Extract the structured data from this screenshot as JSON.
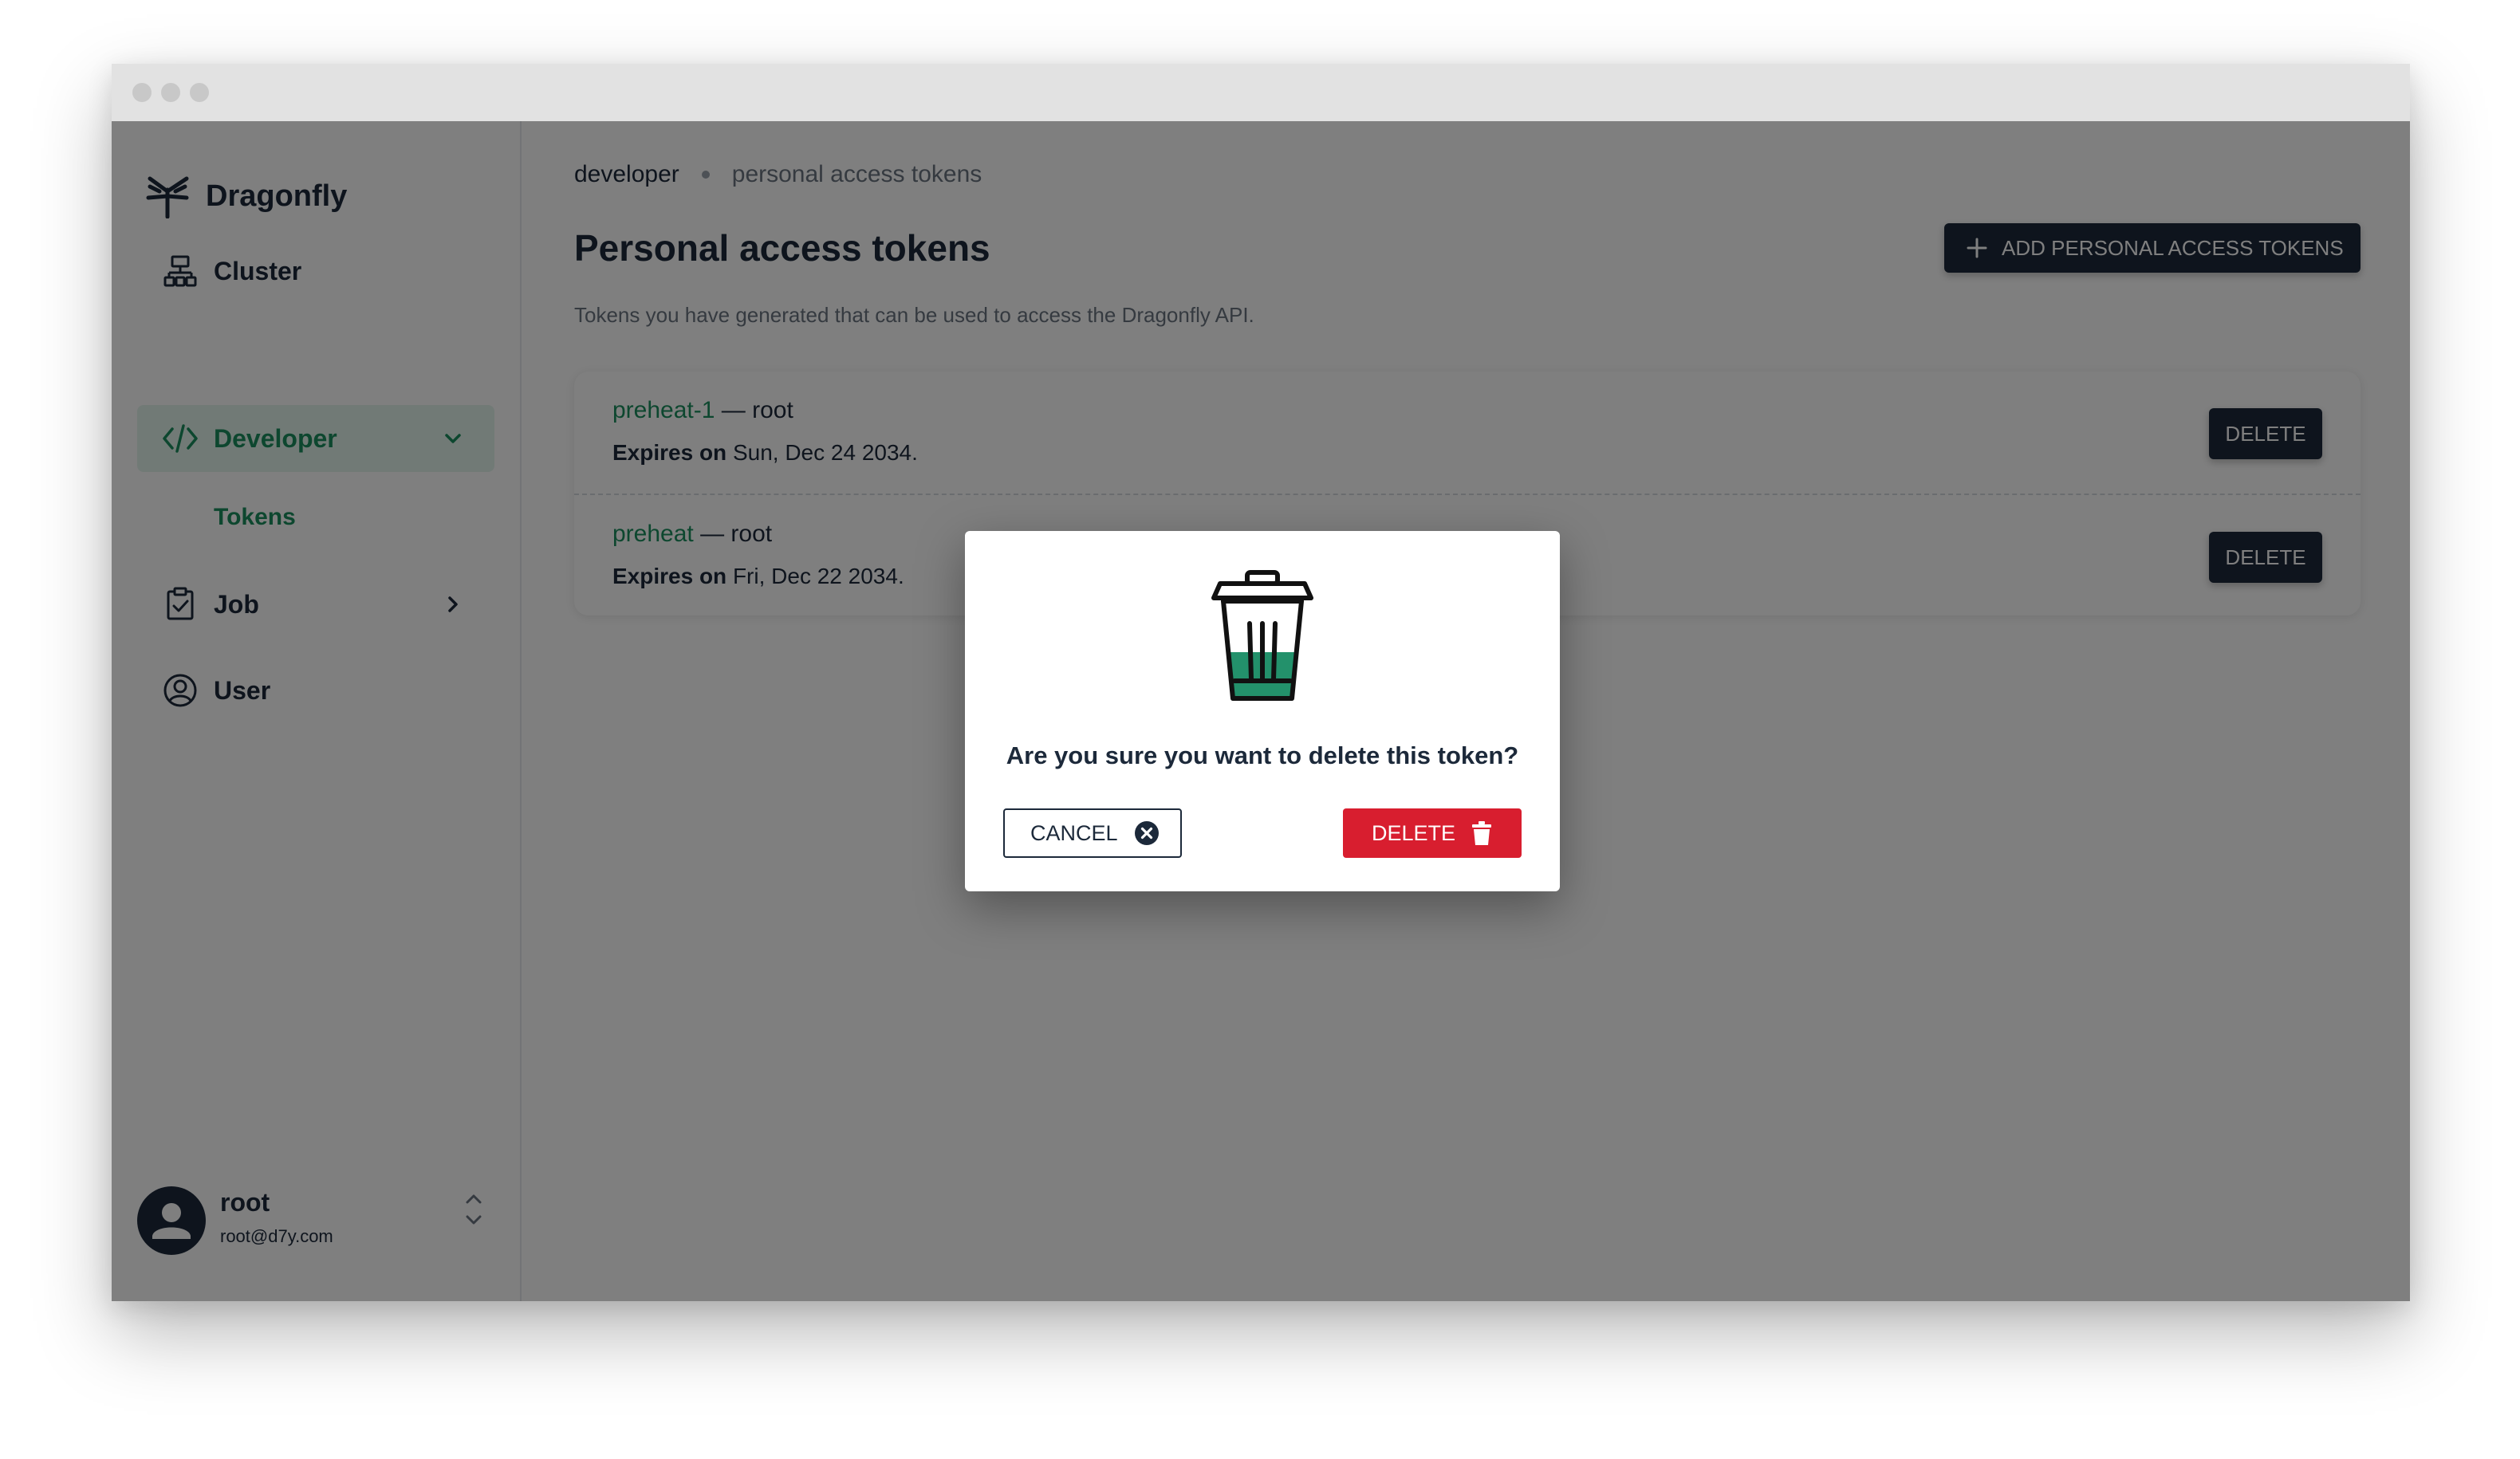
{
  "app": {
    "name": "Dragonfly"
  },
  "sidebar": {
    "items": [
      {
        "label": "Cluster",
        "icon": "cluster-icon"
      },
      {
        "label": "Developer",
        "icon": "code-icon",
        "active": true,
        "expanded": true
      },
      {
        "label": "Job",
        "icon": "clipboard-check-icon"
      },
      {
        "label": "User",
        "icon": "user-circle-icon"
      }
    ],
    "sub_items": [
      {
        "label": "Tokens"
      }
    ],
    "user": {
      "name": "root",
      "email": "root@d7y.com"
    }
  },
  "breadcrumb": {
    "items": [
      "developer",
      "personal access tokens"
    ]
  },
  "page": {
    "title": "Personal access tokens",
    "description": "Tokens you have generated that can be used to access the Dragonfly API.",
    "add_button": "ADD PERSONAL ACCESS TOKENS"
  },
  "tokens": [
    {
      "name": "preheat-1",
      "owner": "— root",
      "expires_label": "Expires on",
      "expires": "Sun, Dec 24 2034.",
      "delete_label": "DELETE"
    },
    {
      "name": "preheat",
      "owner": "— root",
      "expires_label": "Expires on",
      "expires": "Fri, Dec 22 2034.",
      "delete_label": "DELETE"
    }
  ],
  "modal": {
    "question": "Are you sure you want to delete this token?",
    "cancel_label": "CANCEL",
    "delete_label": "DELETE"
  },
  "colors": {
    "primary_dark": "#1c293a",
    "accent_green": "#1b8f5e",
    "danger": "#d81e2f",
    "active_bg": "#e3f4ec"
  }
}
